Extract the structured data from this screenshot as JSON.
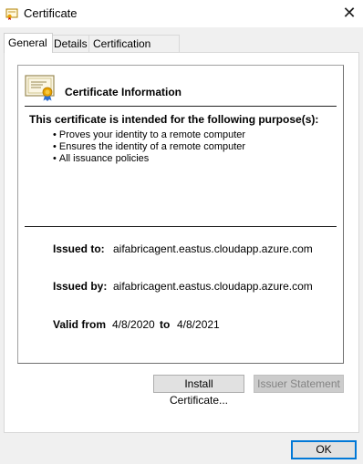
{
  "window": {
    "title": "Certificate",
    "close_glyph": "✕"
  },
  "tabs": [
    {
      "label": "General",
      "active": true
    },
    {
      "label": "Details",
      "active": false
    },
    {
      "label": "Certification Path",
      "active": false
    }
  ],
  "info": {
    "title": "Certificate Information",
    "purpose_heading": "This certificate is intended for the following purpose(s):",
    "purposes": [
      "Proves your identity to a remote computer",
      "Ensures the identity of a remote computer",
      "All issuance policies"
    ],
    "issued_to_label": "Issued to:",
    "issued_to_value": "aifabricagent.eastus.cloudapp.azure.com",
    "issued_by_label": "Issued by:",
    "issued_by_value": "aifabricagent.eastus.cloudapp.azure.com",
    "valid_from_label": "Valid from",
    "valid_from_value": "4/8/2020",
    "to_label": "to",
    "valid_to_value": "4/8/2021"
  },
  "buttons": {
    "install": "Install Certificate...",
    "issuer_statement": "Issuer Statement",
    "ok": "OK"
  },
  "icons": {
    "title": "certificate-icon",
    "info": "certificate-ribbon-icon",
    "close": "close-icon"
  },
  "colors": {
    "accent": "#0078d7",
    "ribbon": "#e8a200"
  }
}
